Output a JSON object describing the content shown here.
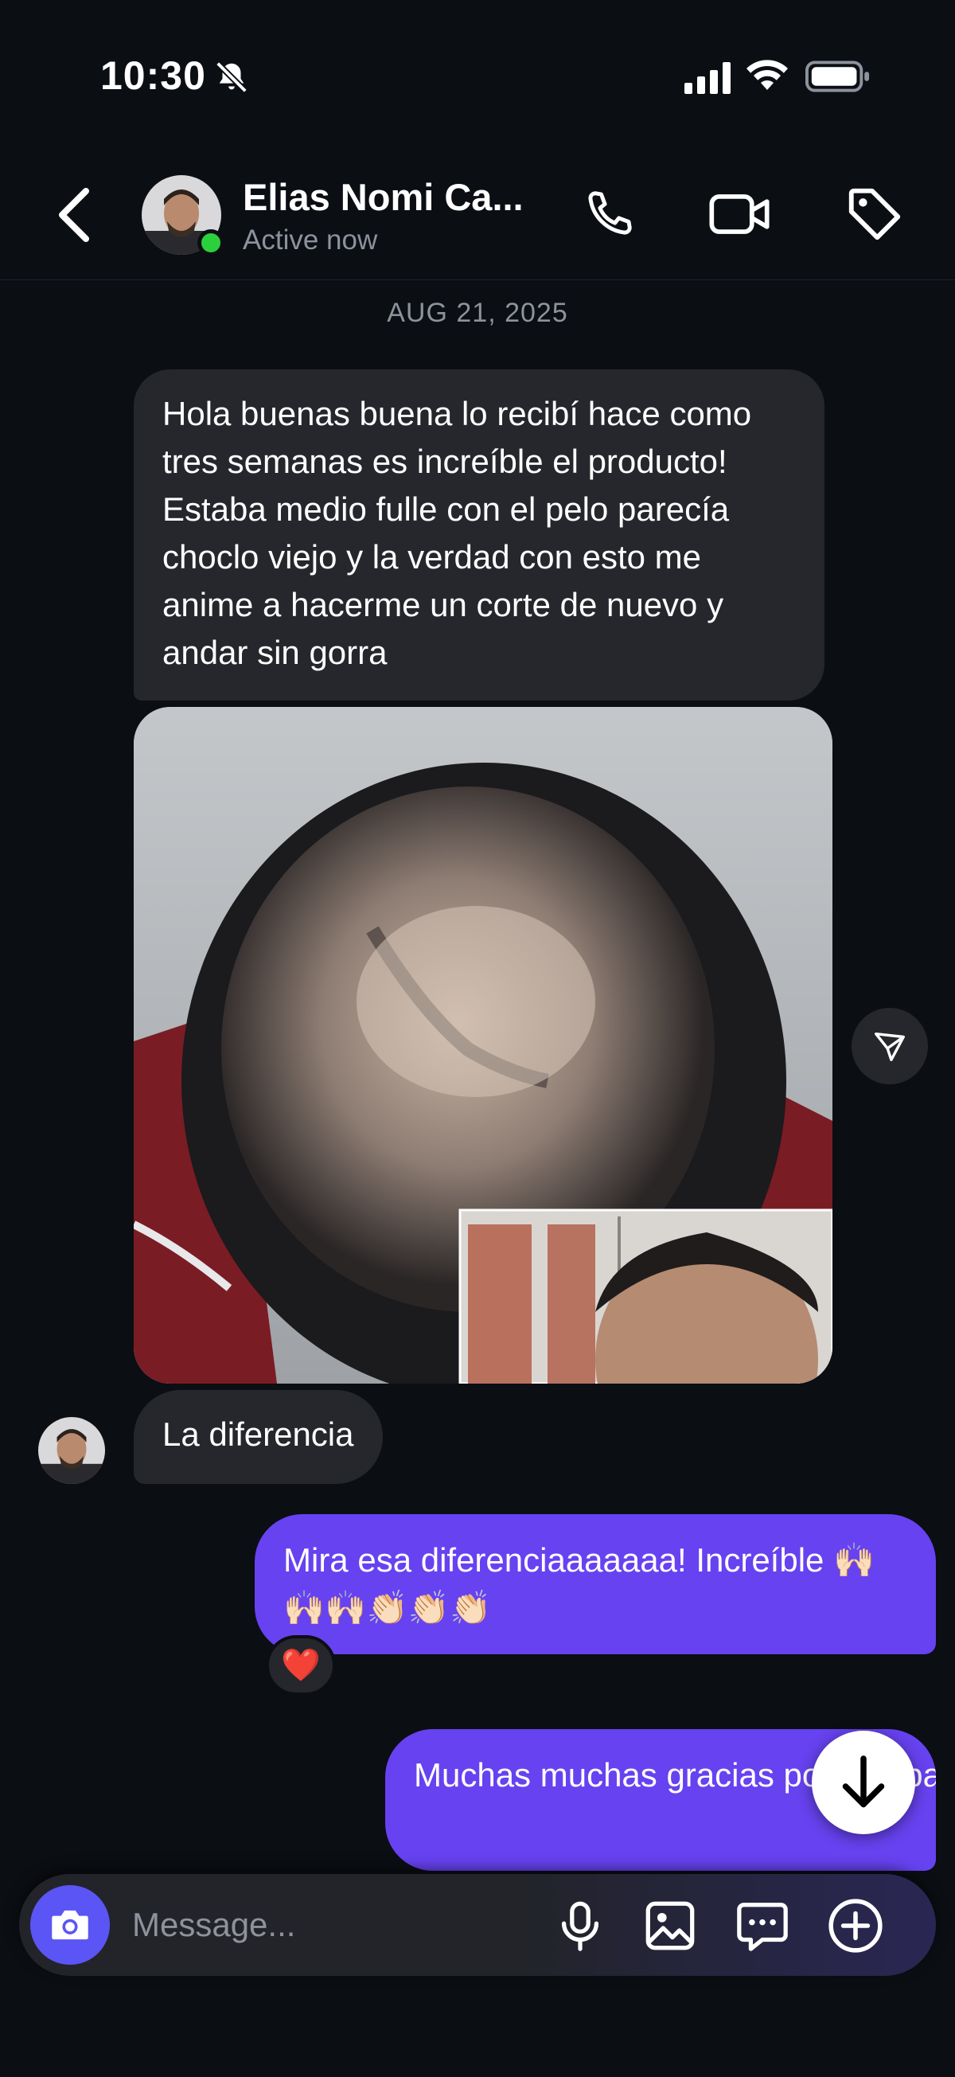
{
  "status_bar": {
    "time": "10:30"
  },
  "header": {
    "contact_name": "Elias Nomi Ca...",
    "contact_status": "Active now"
  },
  "conversation": {
    "date": "AUG 21, 2025",
    "messages": [
      {
        "direction": "incoming",
        "text": "Hola buenas buena lo recibí hace como tres semanas  es increíble el producto! Estaba medio fulle  con el pelo parecía choclo viejo y la verdad con esto me anime a hacerme un corte de nuevo y andar sin gorra"
      },
      {
        "direction": "incoming",
        "type": "photo"
      },
      {
        "direction": "incoming",
        "text": "La diferencia"
      },
      {
        "direction": "outgoing",
        "text": "Mira esa diferenciaaaaaaa! Increíble 🙌🏻🙌🏻🙌🏻👏🏻👏🏻👏🏻",
        "reaction": "❤️"
      },
      {
        "direction": "outgoing",
        "text": "Muchas muchas gracias por compartirnos el resultado!"
      }
    ]
  },
  "composer": {
    "placeholder": "Message..."
  },
  "icons": {
    "back": "chevron-left-icon",
    "call": "phone-icon",
    "video": "video-camera-icon",
    "tag": "tag-icon",
    "share": "send-icon",
    "scroll": "arrow-down-icon",
    "camera": "camera-icon",
    "mic": "microphone-icon",
    "gallery": "image-icon",
    "sticker": "chat-bubble-icon",
    "plus": "plus-circle-icon"
  },
  "colors": {
    "background": "#0b0e13",
    "incoming_bubble": "#25272c",
    "outgoing_bubble": "#6742f0",
    "online": "#2bd13c",
    "camera_button": "#5b55f5"
  }
}
